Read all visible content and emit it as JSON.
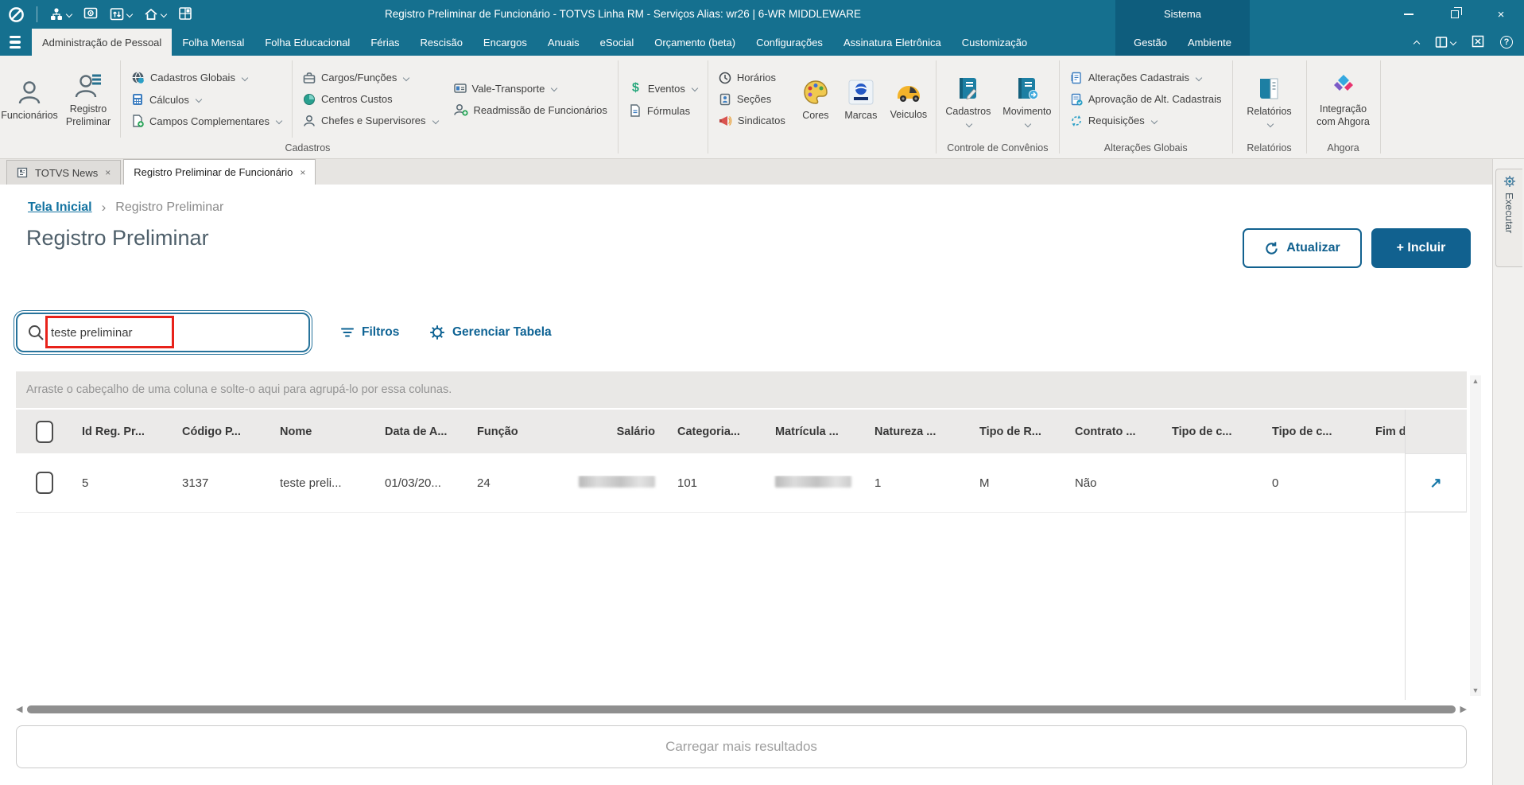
{
  "colors": {
    "titlebar": "#15708f",
    "titlebar_dark": "#0e5d7d",
    "accent_blue": "#11618f",
    "link_blue": "#1373a1",
    "annotation_red": "#e8221a",
    "ribbon_bg": "#f1f0ee"
  },
  "icons": {
    "close": "×",
    "tab_close": "×",
    "help": "?",
    "open_record": "↗",
    "scroll_up": "▲",
    "scroll_down": "▼",
    "scroll_left": "◀",
    "scroll_right": "▶",
    "breadcrumb_sep": "›",
    "dollar": "$"
  },
  "window": {
    "title": "Registro Preliminar de Funcionário - TOTVS Linha RM - Serviços  Alias: wr26 | 6-WR MIDDLEWARE",
    "sistema_label": "Sistema"
  },
  "menubar": {
    "tabs": [
      {
        "label": "Administração de Pessoal"
      },
      {
        "label": "Folha Mensal"
      },
      {
        "label": "Folha Educacional"
      },
      {
        "label": "Férias"
      },
      {
        "label": "Rescisão"
      },
      {
        "label": "Encargos"
      },
      {
        "label": "Anuais"
      },
      {
        "label": "eSocial"
      },
      {
        "label": "Orçamento (beta)"
      },
      {
        "label": "Configurações"
      },
      {
        "label": "Assinatura Eletrônica"
      },
      {
        "label": "Customização"
      }
    ],
    "system_tabs": [
      {
        "label": "Gestão"
      },
      {
        "label": "Ambiente"
      }
    ]
  },
  "ribbon": {
    "buttons": {
      "funcionarios": "Funcionários",
      "registro_preliminar": "Registro Preliminar",
      "cadastros_globais": "Cadastros Globais",
      "calculos": "Cálculos",
      "campos_complementares": "Campos Complementares",
      "cargos_funcoes": "Cargos/Funções",
      "centros_custos": "Centros Custos",
      "chefes_supervisores": "Chefes e Supervisores",
      "vale_transporte": "Vale-Transporte",
      "readmissao": "Readmissão de Funcionários",
      "eventos": "Eventos",
      "formulas": "Fórmulas",
      "horarios": "Horários",
      "secoes": "Seções",
      "sindicatos": "Sindicatos",
      "cores": "Cores",
      "marcas": "Marcas",
      "veiculos": "Veiculos",
      "conv_cadastros": "Cadastros",
      "conv_movimento": "Movimento",
      "alteracoes_cadastrais": "Alterações Cadastrais",
      "aprovacao": "Aprovação de Alt. Cadastrais",
      "requisicoes": "Requisições",
      "relatorios": "Relatórios",
      "integracao_ahgora": "Integração com Ahgora"
    },
    "group_labels": {
      "cadastros": "Cadastros",
      "controle_convenios": "Controle de Convênios",
      "alteracoes_globais": "Alterações Globais",
      "relatorios": "Relatórios",
      "ahgora": "Ahgora"
    }
  },
  "doc_tabs": {
    "news": "TOTVS News",
    "registro": "Registro Preliminar de Funcionário"
  },
  "side_panel": {
    "executar": "Executar"
  },
  "breadcrumb": {
    "home": "Tela Inicial",
    "current": "Registro Preliminar"
  },
  "page": {
    "title": "Registro Preliminar",
    "atualizar": "Atualizar",
    "incluir": "+ Incluir"
  },
  "toolbar": {
    "search_value": "teste preliminar",
    "filtros": "Filtros",
    "gerenciar_tabela": "Gerenciar Tabela"
  },
  "grid": {
    "group_hint": "Arraste o cabeçalho de uma coluna e solte-o aqui para agrupá-lo por essa colunas.",
    "headers": [
      "Id Reg. Pr...",
      "Código P...",
      "Nome",
      "Data de A...",
      "Função",
      "Salário",
      "Categoria...",
      "Matrícula ...",
      "Natureza ...",
      "Tipo de R...",
      "Contrato ...",
      "Tipo de c...",
      "Tipo de c...",
      "Fim d"
    ],
    "row": {
      "id": "5",
      "codigo": "3137",
      "nome": "teste preli...",
      "data_admissao": "01/03/20...",
      "funcao": "24",
      "salario": "",
      "categoria": "101",
      "matricula": "",
      "natureza": "1",
      "tipo_r": "M",
      "contrato": "Não",
      "tipo_c1": "",
      "tipo_c2": "0",
      "fim": ""
    },
    "redacted_columns": [
      "Salário",
      "Matrícula ..."
    ],
    "load_more": "Carregar mais resultados"
  }
}
